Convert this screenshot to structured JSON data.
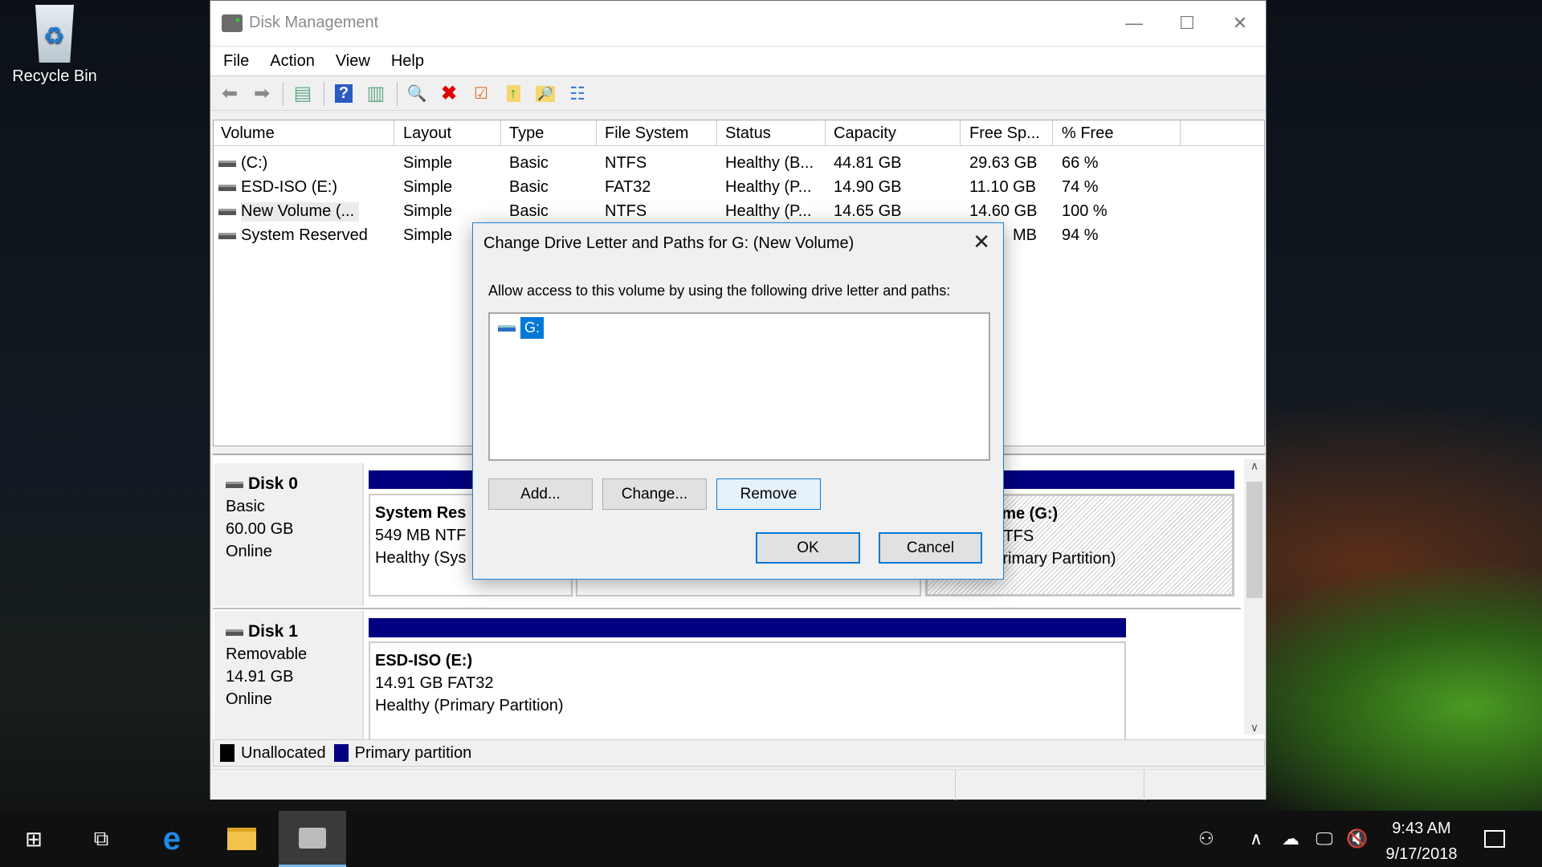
{
  "desktop": {
    "recycle_bin": "Recycle Bin"
  },
  "window": {
    "title": "Disk Management",
    "minimize": "—",
    "maximize": "☐",
    "close": "✕"
  },
  "menu": [
    "File",
    "Action",
    "View",
    "Help"
  ],
  "toolbar": [
    "back-icon",
    "forward-icon",
    "show-hide-console-tree-icon",
    "help-icon",
    "show-action-pane-icon",
    "connect-disk-icon",
    "delete-icon",
    "properties-icon",
    "export-icon",
    "find-icon",
    "checklist-icon"
  ],
  "volumes": {
    "columns": [
      "Volume",
      "Layout",
      "Type",
      "File System",
      "Status",
      "Capacity",
      "Free Sp...",
      "% Free"
    ],
    "rows": [
      [
        "(C:)",
        "Simple",
        "Basic",
        "NTFS",
        "Healthy (B...",
        "44.81 GB",
        "29.63 GB",
        "66 %"
      ],
      [
        "ESD-ISO (E:)",
        "Simple",
        "Basic",
        "FAT32",
        "Healthy (P...",
        "14.90 GB",
        "11.10 GB",
        "74 %"
      ],
      [
        "New Volume (...",
        "Simple",
        "Basic",
        "NTFS",
        "Healthy (P...",
        "14.65 GB",
        "14.60 GB",
        "100 %"
      ],
      [
        "System Reserved",
        "Simple",
        "",
        "",
        "",
        "",
        "MB",
        "94 %"
      ]
    ]
  },
  "disks": [
    {
      "name": "Disk 0",
      "type": "Basic",
      "size": "60.00 GB",
      "state": "Online",
      "partitions": [
        {
          "title": "System Res",
          "line1": "549 MB NTF",
          "line2": "Healthy (Sys"
        },
        {
          "title": "",
          "line1": "",
          "line2": ""
        },
        {
          "title": "ume  (G:)",
          "line1": "NTFS",
          "line2": "Primary Partition)"
        }
      ]
    },
    {
      "name": "Disk 1",
      "type": "Removable",
      "size": "14.91 GB",
      "state": "Online",
      "partitions": [
        {
          "title": "ESD-ISO  (E:)",
          "line1": "14.91 GB FAT32",
          "line2": "Healthy (Primary Partition)"
        }
      ]
    }
  ],
  "legend": [
    {
      "label": "Unallocated",
      "color": "#000000"
    },
    {
      "label": "Primary partition",
      "color": "#000080"
    }
  ],
  "dialog": {
    "title": "Change Drive Letter and Paths for G: (New Volume)",
    "close": "✕",
    "label": "Allow access to this volume by using the following drive letter and paths:",
    "items": [
      "G:"
    ],
    "add": "Add...",
    "change": "Change...",
    "remove": "Remove",
    "ok": "OK",
    "cancel": "Cancel"
  },
  "taskbar": {
    "time": "9:43 AM",
    "date": "9/17/2018"
  }
}
